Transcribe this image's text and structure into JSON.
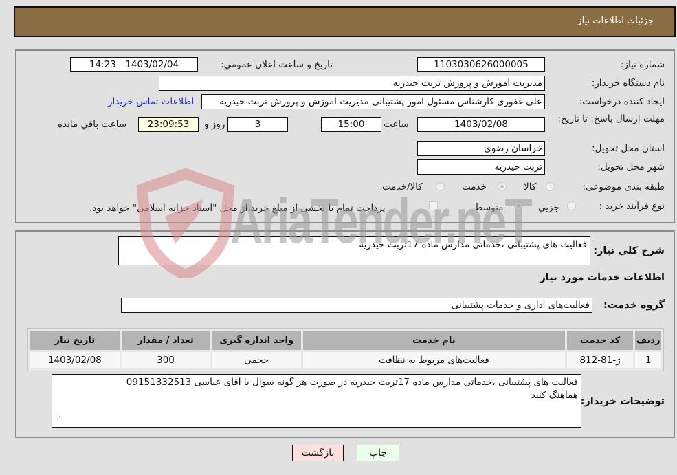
{
  "header": {
    "title": "جزئیات اطلاعات نیاز"
  },
  "form": {
    "need_number_label": "شماره نیاز:",
    "need_number": "1103030626000005",
    "announce_label": "تاریخ و ساعت اعلان عمومي:",
    "announce_value": "1403/02/04 - 14:23",
    "buyer_org_label": "نام دستگاه خریدار:",
    "buyer_org": "مدیریت اموزش و پرورش تربت حیدریه",
    "requester_label": "ایجاد کننده درخواست:",
    "requester": "علی غفوری کارشناس مسئول امور پشتیبانی  مدیریت اموزش و پرورش تربت حیدریه",
    "buyer_contact_link": "اطلاعات تماس خریدار",
    "deadline_label": "مهلت ارسال پاسخ: تا تاریخ:",
    "deadline_date": "1403/02/08",
    "time_label": "ساعت",
    "deadline_time": "15:00",
    "days_value": "3",
    "days_label": "روز و",
    "remaining_time": "23:09:53",
    "remaining_label": "ساعت باقي مانده",
    "province_label": "استان محل تحویل:",
    "province": "خراسان رضوی",
    "city_label": "شهر محل تحویل:",
    "city": "تربت حیدریه",
    "category_label": "طبقه بندی موضوعی:",
    "category_options": [
      {
        "label": "کالا",
        "checked": false
      },
      {
        "label": "خدمت",
        "checked": true
      },
      {
        "label": "کالا/خدمت",
        "checked": false
      }
    ],
    "process_label": "نوع فرآیند خرید :",
    "process_options": [
      {
        "label": "جزيي",
        "checked": false
      },
      {
        "label": "متوسط",
        "checked": true
      }
    ],
    "treasury_note": "پرداخت تمام یا بخشی از مبلغ خرید،از محل \"اسناد خزانه اسلامی\" خواهد بود."
  },
  "details": {
    "summary_label": "شرح كلي نياز:",
    "summary": "فعالیت های پشتیبانی ،خدماتی  مدارس ماده 17تربت حیدریه",
    "services_heading": "اطلاعات خدمات مورد نیاز",
    "service_group_label": "گروه خدمت:",
    "service_group": "فعالیت‌های اداری و خدمات پشتیبانی",
    "table": {
      "headers": [
        "ردیف",
        "کد خدمت",
        "نام خدمت",
        "واحد اندازه گیری",
        "تعداد / مقدار",
        "تاریخ نیاز"
      ],
      "rows": [
        [
          "1",
          "ژ-81-812",
          "فعالیت‌های مربوط به نظافت",
          "حجمی",
          "300",
          "1403/02/08"
        ]
      ]
    },
    "buyer_notes_label": "توضیحات خریدار:",
    "buyer_notes_line1": "فعالیت های پشتیبانی ،خدماتی  مدارس ماده 17تربت حیدریه در صورت هر گونه سوال با آقای عباسی 09151332513",
    "buyer_notes_line2": "هماهنگ کنید"
  },
  "buttons": {
    "print": "چاپ",
    "back": "بازگشت"
  },
  "watermark": {
    "text": "AriaTender.neT"
  }
}
